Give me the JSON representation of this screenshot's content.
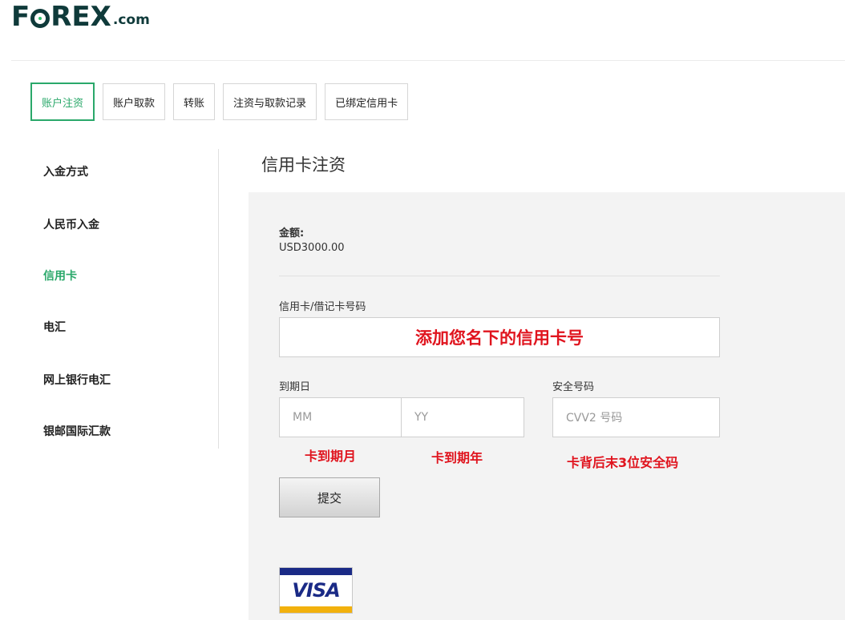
{
  "logo": {
    "main_part1": "F",
    "main_part2": "REX",
    "suffix": ".com"
  },
  "tabs": [
    {
      "label": "账户注资",
      "active": true
    },
    {
      "label": "账户取款",
      "active": false
    },
    {
      "label": "转账",
      "active": false
    },
    {
      "label": "注资与取款记录",
      "active": false
    },
    {
      "label": "已绑定信用卡",
      "active": false
    }
  ],
  "sidebar": {
    "items": [
      {
        "label": "入金方式",
        "active": false
      },
      {
        "label": "人民币入金",
        "active": false
      },
      {
        "label": "信用卡",
        "active": true
      },
      {
        "label": "电汇",
        "active": false
      },
      {
        "label": "网上银行电汇",
        "active": false
      },
      {
        "label": "银邮国际汇款",
        "active": false
      }
    ]
  },
  "main": {
    "title": "信用卡注资",
    "amount_label": "金额:",
    "amount_value": "USD3000.00",
    "card_label": "信用卡/借记卡号码",
    "card_note": "添加您名下的信用卡号",
    "expiry_label": "到期日",
    "month_placeholder": "MM",
    "year_placeholder": "YY",
    "cvv_label": "安全号码",
    "cvv_placeholder": "CVV2 号码",
    "month_note": "卡到期月",
    "year_note": "卡到期年",
    "cvv_note": "卡背后末3位安全码",
    "submit_label": "提交",
    "visa_text": "VISA"
  },
  "colors": {
    "accent": "#2aa86a",
    "note_red": "#e0141e",
    "logo_dark": "#0f3a3a",
    "visa_blue": "#1a2a86",
    "visa_gold": "#f2b10d"
  }
}
